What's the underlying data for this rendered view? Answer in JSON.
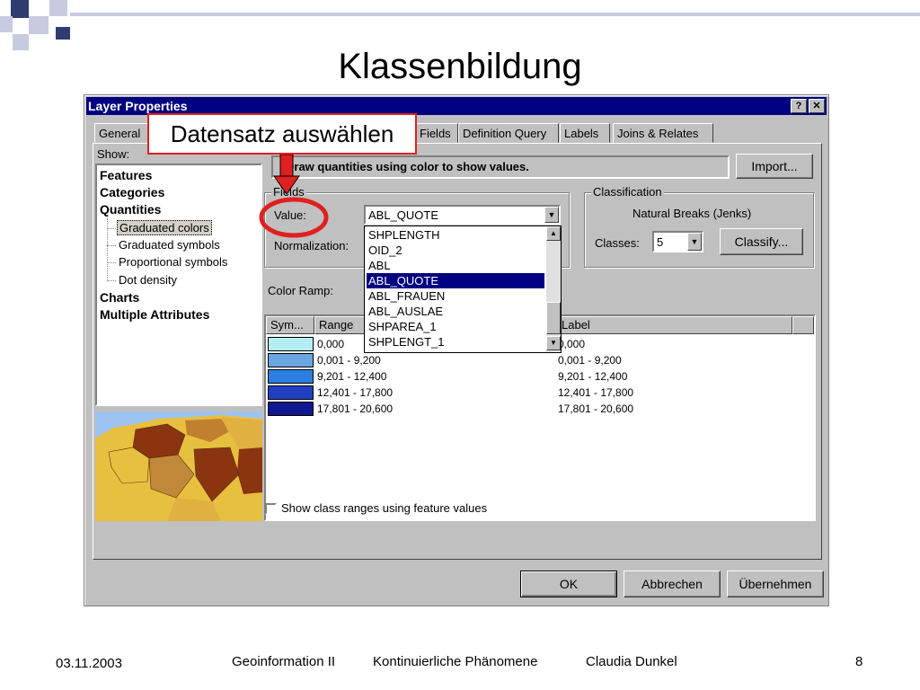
{
  "slide": {
    "title": "Klassenbildung",
    "footer": {
      "date": "03.11.2003",
      "course": "Geoinformation II",
      "topic": "Kontinuierliche Phänomene",
      "author": "Claudia Dunkel",
      "page": "8"
    },
    "callout": "Datensatz auswählen"
  },
  "dialog": {
    "title": "Layer Properties",
    "help_button": "?",
    "close_button": "✕",
    "tabs": [
      "General",
      "Fields",
      "Definition Query",
      "Labels",
      "Joins & Relates"
    ],
    "show_label": "Show:",
    "tree": {
      "features": "Features",
      "categories": "Categories",
      "quantities": "Quantities",
      "sub": [
        "Graduated colors",
        "Graduated symbols",
        "Proportional symbols",
        "Dot density"
      ],
      "charts": "Charts",
      "multiple": "Multiple Attributes"
    },
    "description": "Draw quantities using color to show values.",
    "import_button": "Import...",
    "fields_group": "Fields",
    "value_label": "Value:",
    "value_selected": "ABL_QUOTE",
    "normalization_label": "Normalization:",
    "dropdown_options": [
      "SHPLENGTH",
      "OID_2",
      "ABL",
      "ABL_QUOTE",
      "ABL_FRAUEN",
      "ABL_AUSLAE",
      "SHPAREA_1",
      "SHPLENGT_1"
    ],
    "dropdown_selected_index": 3,
    "classification_group": "Classification",
    "classification_method": "Natural Breaks (Jenks)",
    "classes_label": "Classes:",
    "classes_value": "5",
    "classify_button": "Classify...",
    "color_ramp_label": "Color Ramp:",
    "table_headers": [
      "Sym...",
      "Range",
      "Label"
    ],
    "rows": [
      {
        "color": "#b4eef4",
        "range": "0,000",
        "label": "0,000"
      },
      {
        "color": "#6aa6e0",
        "range": "0,001 - 9,200",
        "label": "0,001 - 9,200"
      },
      {
        "color": "#2c7ee0",
        "range": "9,201 - 12,400",
        "label": "9,201 - 12,400"
      },
      {
        "color": "#2040c0",
        "range": "12,401 - 17,800",
        "label": "12,401 - 17,800"
      },
      {
        "color": "#101890",
        "range": "17,801 - 20,600",
        "label": "17,801 - 20,600"
      }
    ],
    "show_class_ranges": "Show class ranges using feature values",
    "ok_button": "OK",
    "cancel_button": "Abbrechen",
    "apply_button": "Übernehmen"
  }
}
